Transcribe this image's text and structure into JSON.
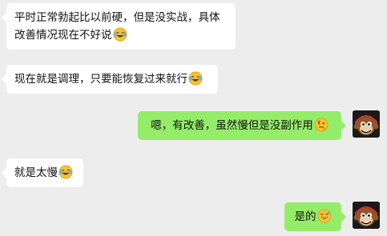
{
  "chat": {
    "messages": [
      {
        "side": "incoming",
        "text": "平时正常勃起比以前硬，但是没实战，具体改善情况现在不好说",
        "emoji": "laughing-crying-emoji"
      },
      {
        "side": "incoming",
        "text": "现在就是调理，只要能恢复过来就行",
        "emoji": "laughing-crying-emoji"
      },
      {
        "side": "outgoing",
        "text": "嗯，有改善，虽然慢但是没副作用",
        "emoji": "thinking-face-emoji"
      },
      {
        "side": "incoming",
        "text": "就是太慢",
        "emoji": "laughing-crying-emoji"
      },
      {
        "side": "outgoing",
        "text": "是的",
        "emoji": "grinning-sweat-emoji"
      }
    ]
  },
  "colors": {
    "background": "#ededed",
    "incoming_bubble": "#ffffff",
    "outgoing_bubble": "#95ec69",
    "text": "#111111"
  }
}
